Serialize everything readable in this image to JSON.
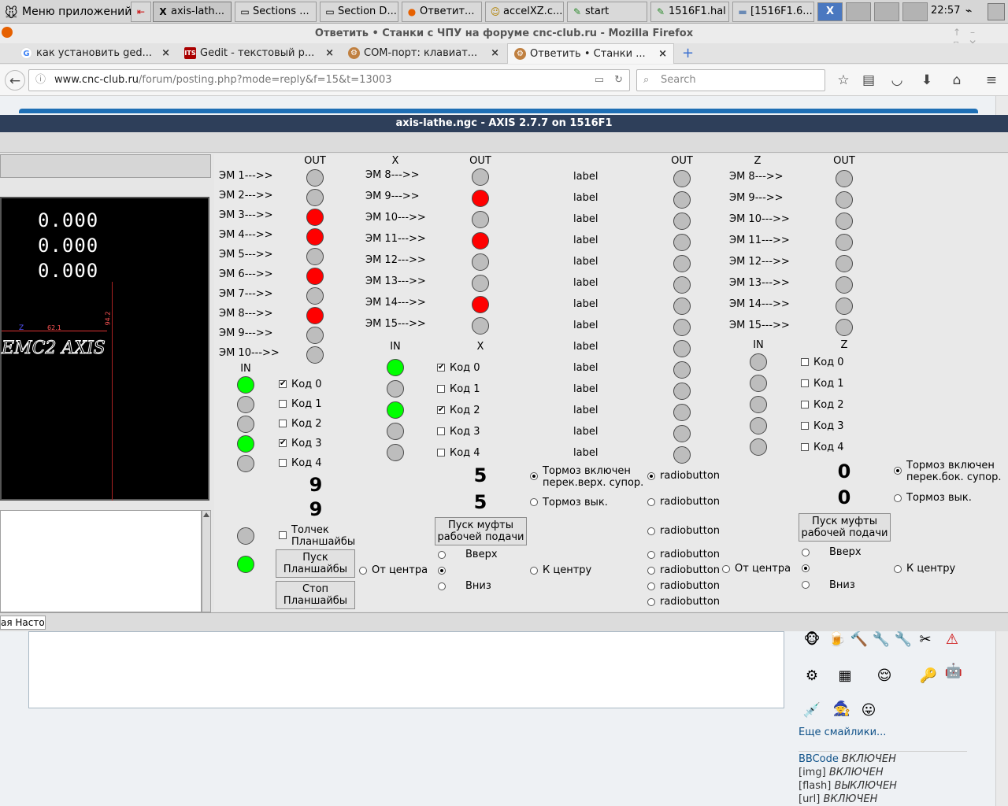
{
  "taskbar": {
    "menu_label": "Меню приложений",
    "items": [
      "axis-lath...",
      "Sections ...",
      "Section D...",
      "Ответит...",
      "accelXZ.c...",
      "start",
      "1516F1.hal",
      "[1516F1.6..."
    ],
    "clock": "22:57"
  },
  "firefox": {
    "title": "Ответить • Станки с ЧПУ на форуме cnc-club.ru - Mozilla Firefox",
    "tabs": [
      "как установить ged...",
      "Gedit - текстовый р...",
      "COM-порт: клавиат...",
      "Ответить • Станки ..."
    ],
    "url_host": "www.cnc-club.ru",
    "url_path": "/forum/posting.php?mode=reply&f=15&t=13003",
    "search_placeholder": "Search"
  },
  "axis": {
    "title": "axis-lathe.ngc - AXIS 2.7.7 on 1516F1",
    "dro": [
      "0.000",
      "0.000",
      "0.000"
    ],
    "logo_text": "EMC2 AXIS",
    "dim1": "62.1",
    "dim2": "94.2",
    "z_marker": "Z",
    "status_text": "ая Насто"
  },
  "panel": {
    "out": "OUT",
    "in": "IN",
    "x": "X",
    "z": "Z",
    "label": "label",
    "radiobutton": "radiobutton",
    "col1_labels": [
      "ЭМ 1--->>",
      "ЭМ 2--->>",
      "ЭМ 3--->>",
      "ЭМ 4--->>",
      "ЭМ 5--->>",
      "ЭМ 6--->>",
      "ЭМ 7--->>",
      "ЭМ 8--->>",
      "ЭМ 9--->>",
      "ЭМ 10--->>"
    ],
    "col1_states": [
      "off",
      "off",
      "red",
      "red",
      "off",
      "red",
      "off",
      "red",
      "off",
      "off"
    ],
    "col2_labels": [
      "ЭМ 8--->>",
      "ЭМ 9--->>",
      "ЭМ 10--->>",
      "ЭМ 11--->>",
      "ЭМ 12--->>",
      "ЭМ 13--->>",
      "ЭМ 14--->>",
      "ЭМ 15--->>"
    ],
    "col2_states": [
      "off",
      "red",
      "off",
      "red",
      "off",
      "off",
      "red",
      "off"
    ],
    "col4_labels": [
      "ЭМ 8--->>",
      "ЭМ 9--->>",
      "ЭМ 10--->>",
      "ЭМ 11--->>",
      "ЭМ 12--->>",
      "ЭМ 13--->>",
      "ЭМ 14--->>",
      "ЭМ 15--->>"
    ],
    "codes": [
      "Код 0",
      "Код 1",
      "Код 2",
      "Код 3",
      "Код 4"
    ],
    "left_in_states": [
      "green",
      "off",
      "off",
      "green",
      "off"
    ],
    "left_codes_checked": [
      true,
      false,
      false,
      true,
      false
    ],
    "x_in_states": [
      "green",
      "off",
      "green",
      "off",
      "off"
    ],
    "x_codes_checked": [
      true,
      false,
      true,
      false,
      false
    ],
    "z_codes_checked": [
      false,
      false,
      false,
      false,
      false
    ],
    "num_left": [
      "9",
      "9"
    ],
    "num_x": [
      "5",
      "5"
    ],
    "num_z": [
      "0",
      "0"
    ],
    "jog_label": "Толчек\nПланшайбы",
    "start_faceplate": "Пуск\nПланшайбы",
    "stop_faceplate": "Стоп\nПланшайбы",
    "brake_on_x": "Тормоз включен\nперек.верх. супор.",
    "brake_off": "Тормоз вык.",
    "brake_on_z": "Тормоз включен\nперек.бок. супор.",
    "clutch": "Пуск муфты\nрабочей подачи",
    "up": "Вверх",
    "down": "Вниз",
    "from_center": "От центра",
    "to_center": "К центру"
  },
  "forum": {
    "more_smilies": "Еще смайлики...",
    "bbcode": [
      {
        "name": "BBCode",
        "state": "ВКЛЮЧЕН"
      },
      {
        "name": "[img]",
        "state": "ВКЛЮЧЕН"
      },
      {
        "name": "[flash]",
        "state": "ВЫКЛЮЧЕН"
      },
      {
        "name": "[url]",
        "state": "ВКЛЮЧЕН"
      }
    ]
  }
}
